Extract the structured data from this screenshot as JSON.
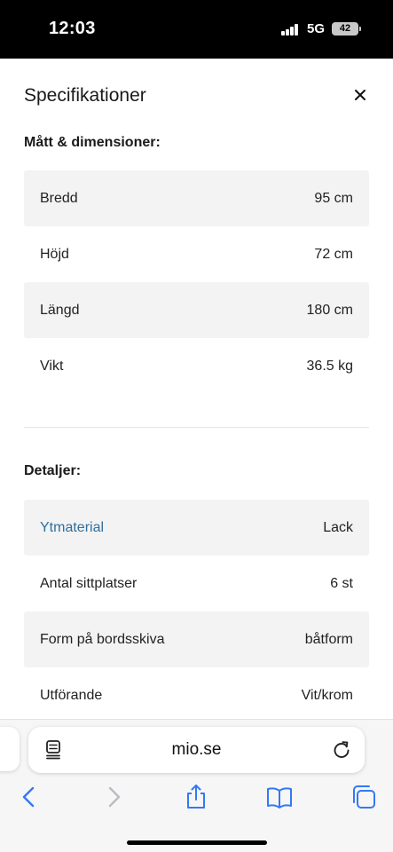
{
  "status_bar": {
    "time": "12:03",
    "network": "5G",
    "battery": "42"
  },
  "sheet": {
    "title": "Specifikationer",
    "dimensions": {
      "heading": "Mått & dimensioner:",
      "rows": [
        {
          "label": "Bredd",
          "value": "95 cm"
        },
        {
          "label": "Höjd",
          "value": "72 cm"
        },
        {
          "label": "Längd",
          "value": "180 cm"
        },
        {
          "label": "Vikt",
          "value": "36.5 kg"
        }
      ]
    },
    "details": {
      "heading": "Detaljer:",
      "rows": [
        {
          "label": "Ytmaterial",
          "value": "Lack"
        },
        {
          "label": "Antal sittplatser",
          "value": "6 st"
        },
        {
          "label": "Form på bordsskiva",
          "value": "båtform"
        },
        {
          "label": "Utförande",
          "value": "Vit/krom"
        }
      ]
    }
  },
  "browser": {
    "address": "mio.se",
    "link_color": "#2f6f9f",
    "toolbar_icons": [
      "back-icon",
      "forward-icon",
      "share-icon",
      "bookmarks-icon",
      "tabs-icon"
    ]
  }
}
